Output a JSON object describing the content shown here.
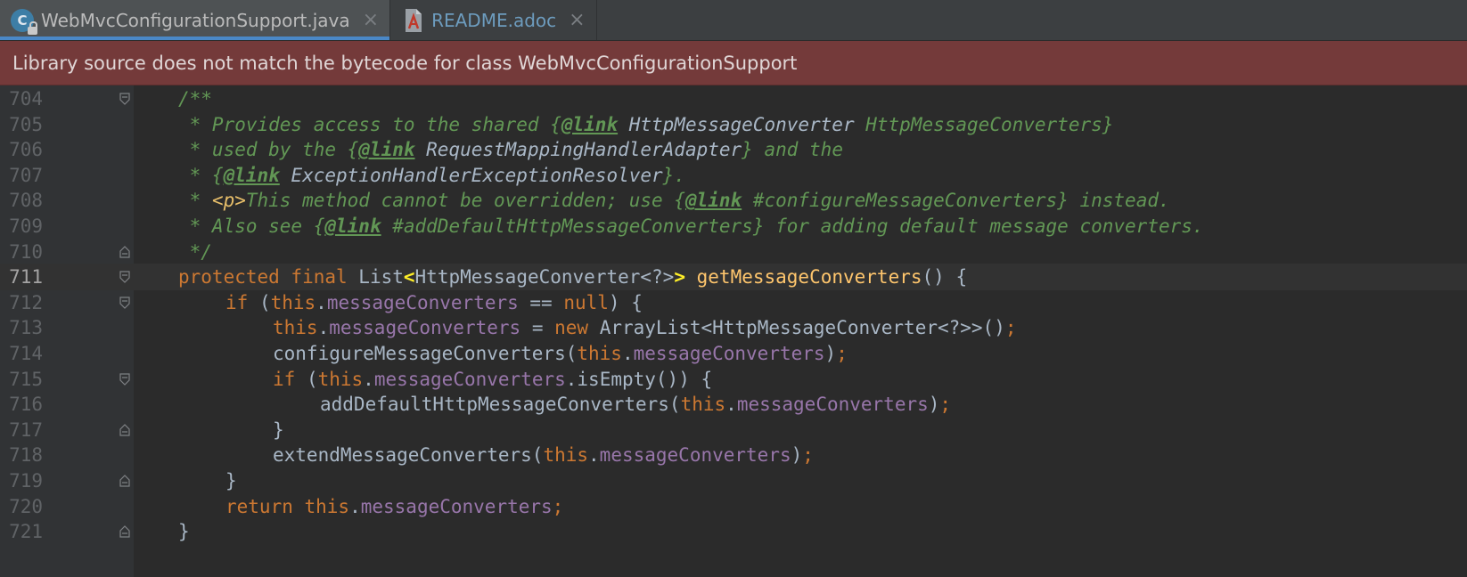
{
  "tabs": [
    {
      "label": "WebMvcConfigurationSupport.java",
      "icon": "java-class-icon",
      "close": "×",
      "active": true
    },
    {
      "label": "README.adoc",
      "icon": "asciidoc-file-icon",
      "close": "×",
      "active": false
    }
  ],
  "tab_icon_letter": "C",
  "banner": {
    "message": "Library source does not match the bytecode for class WebMvcConfigurationSupport"
  },
  "colors": {
    "banner_bg": "#743a3a",
    "editor_bg": "#2b2b2b",
    "keyword": "#cc7832",
    "javadoc": "#629755",
    "field": "#9876aa",
    "method": "#ffc66d",
    "active_tab_underline": "#4a88c7"
  },
  "editor": {
    "current_line": "711",
    "lines": [
      {
        "number": "704",
        "fold": "open",
        "indent": 0,
        "tokens": [
          [
            "doc",
            "/**"
          ]
        ]
      },
      {
        "number": "705",
        "fold": "",
        "indent": 0,
        "tokens": [
          [
            "doc",
            " * Provides access to the shared {"
          ],
          [
            "tag",
            "@link"
          ],
          [
            "ref",
            " HttpMessageConverter"
          ],
          [
            "doc",
            " HttpMessageConverters}"
          ]
        ]
      },
      {
        "number": "706",
        "fold": "",
        "indent": 0,
        "tokens": [
          [
            "doc",
            " * used by the {"
          ],
          [
            "tag",
            "@link"
          ],
          [
            "ref",
            " RequestMappingHandlerAdapter"
          ],
          [
            "doc",
            "} and the"
          ]
        ]
      },
      {
        "number": "707",
        "fold": "",
        "indent": 0,
        "tokens": [
          [
            "doc",
            " * {"
          ],
          [
            "tag",
            "@link"
          ],
          [
            "ref",
            " ExceptionHandlerExceptionResolver"
          ],
          [
            "doc",
            "}."
          ]
        ]
      },
      {
        "number": "708",
        "fold": "",
        "indent": 0,
        "tokens": [
          [
            "doc",
            " * "
          ],
          [
            "ptag",
            "<p>"
          ],
          [
            "doc",
            "This method cannot be overridden; use {"
          ],
          [
            "tag",
            "@link"
          ],
          [
            "doc",
            " #configureMessageConverters} instead."
          ]
        ]
      },
      {
        "number": "709",
        "fold": "",
        "indent": 0,
        "tokens": [
          [
            "doc",
            " * Also see {"
          ],
          [
            "tag",
            "@link"
          ],
          [
            "doc",
            " #addDefaultHttpMessageConverters} for adding default message converters."
          ]
        ]
      },
      {
        "number": "710",
        "fold": "close",
        "indent": 0,
        "tokens": [
          [
            "doc",
            " */"
          ]
        ]
      },
      {
        "number": "711",
        "fold": "open",
        "indent": 0,
        "tokens": [
          [
            "kw",
            "protected final "
          ],
          [
            "id",
            "List"
          ],
          [
            "brace",
            "<"
          ],
          [
            "id",
            "HttpMessageConverter<?>"
          ],
          [
            "brace",
            ">"
          ],
          [
            "id",
            " "
          ],
          [
            "method",
            "getMessageConverters"
          ],
          [
            "id",
            "() {"
          ]
        ]
      },
      {
        "number": "712",
        "fold": "open",
        "indent": 1,
        "tokens": [
          [
            "kw",
            "if "
          ],
          [
            "id",
            "("
          ],
          [
            "kw",
            "this"
          ],
          [
            "id",
            "."
          ],
          [
            "field",
            "messageConverters"
          ],
          [
            "id",
            " == "
          ],
          [
            "kw",
            "null"
          ],
          [
            "id",
            ") {"
          ]
        ]
      },
      {
        "number": "713",
        "fold": "",
        "indent": 2,
        "tokens": [
          [
            "kw",
            "this"
          ],
          [
            "id",
            "."
          ],
          [
            "field",
            "messageConverters"
          ],
          [
            "id",
            " = "
          ],
          [
            "kw",
            "new "
          ],
          [
            "id",
            "ArrayList<HttpMessageConverter<?>>()"
          ],
          [
            "punc",
            ";"
          ]
        ]
      },
      {
        "number": "714",
        "fold": "",
        "indent": 2,
        "tokens": [
          [
            "id",
            "configureMessageConverters("
          ],
          [
            "kw",
            "this"
          ],
          [
            "id",
            "."
          ],
          [
            "field",
            "messageConverters"
          ],
          [
            "id",
            ")"
          ],
          [
            "punc",
            ";"
          ]
        ]
      },
      {
        "number": "715",
        "fold": "open",
        "indent": 2,
        "tokens": [
          [
            "kw",
            "if "
          ],
          [
            "id",
            "("
          ],
          [
            "kw",
            "this"
          ],
          [
            "id",
            "."
          ],
          [
            "field",
            "messageConverters"
          ],
          [
            "id",
            ".isEmpty()) {"
          ]
        ]
      },
      {
        "number": "716",
        "fold": "",
        "indent": 3,
        "tokens": [
          [
            "id",
            "addDefaultHttpMessageConverters("
          ],
          [
            "kw",
            "this"
          ],
          [
            "id",
            "."
          ],
          [
            "field",
            "messageConverters"
          ],
          [
            "id",
            ")"
          ],
          [
            "punc",
            ";"
          ]
        ]
      },
      {
        "number": "717",
        "fold": "close",
        "indent": 2,
        "tokens": [
          [
            "id",
            "}"
          ]
        ]
      },
      {
        "number": "718",
        "fold": "",
        "indent": 2,
        "tokens": [
          [
            "id",
            "extendMessageConverters("
          ],
          [
            "kw",
            "this"
          ],
          [
            "id",
            "."
          ],
          [
            "field",
            "messageConverters"
          ],
          [
            "id",
            ")"
          ],
          [
            "punc",
            ";"
          ]
        ]
      },
      {
        "number": "719",
        "fold": "close",
        "indent": 1,
        "tokens": [
          [
            "id",
            "}"
          ]
        ]
      },
      {
        "number": "720",
        "fold": "",
        "indent": 1,
        "tokens": [
          [
            "kw",
            "return this"
          ],
          [
            "id",
            "."
          ],
          [
            "field",
            "messageConverters"
          ],
          [
            "punc",
            ";"
          ]
        ]
      },
      {
        "number": "721",
        "fold": "close",
        "indent": 0,
        "tokens": [
          [
            "id",
            "}"
          ]
        ]
      }
    ]
  }
}
